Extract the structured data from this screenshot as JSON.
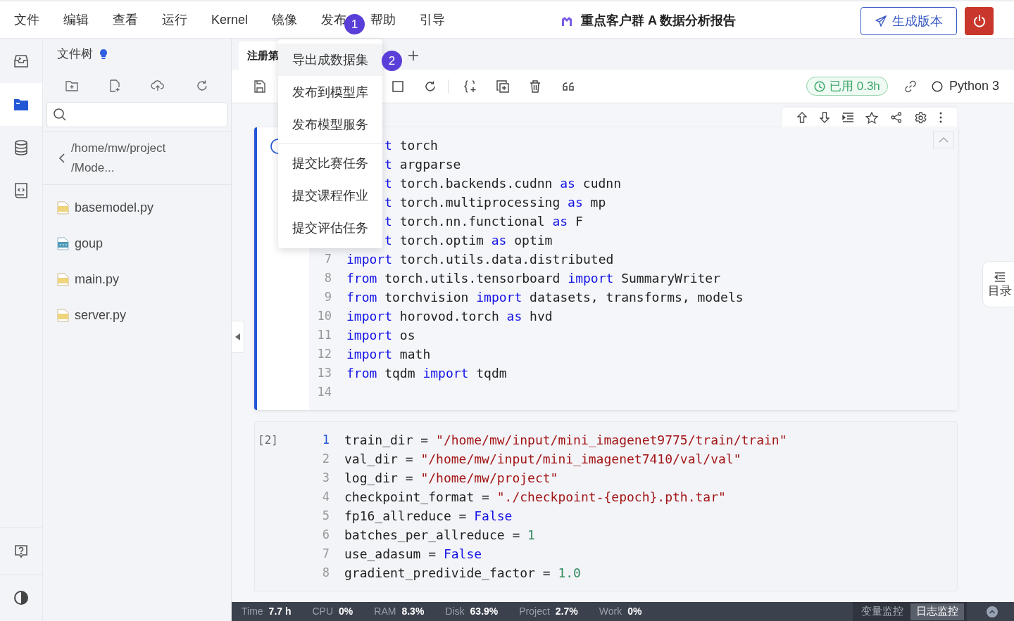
{
  "menu_bar": {
    "items": [
      {
        "label": "文件"
      },
      {
        "label": "编辑"
      },
      {
        "label": "查看"
      },
      {
        "label": "运行"
      },
      {
        "label": "Kernel"
      },
      {
        "label": "镜像"
      },
      {
        "label": "发布"
      },
      {
        "label": "帮助"
      },
      {
        "label": "引导"
      }
    ],
    "title": "重点客户群 A 数据分析报告",
    "generate_button": "生成版本"
  },
  "activity_bar": {
    "items": [
      {
        "selected": false
      },
      {
        "selected": true
      },
      {
        "selected": false
      },
      {
        "selected": false
      }
    ]
  },
  "file_panel": {
    "title": "文件树",
    "path_lines": [
      "/home/mw/project",
      "/Mode..."
    ],
    "files": [
      {
        "name": "basemodel.py",
        "kind": "py"
      },
      {
        "name": "goup",
        "kind": "binary"
      },
      {
        "name": "main.py",
        "kind": "py"
      },
      {
        "name": "server.py",
        "kind": "py"
      }
    ]
  },
  "publish_menu": {
    "items": [
      {
        "kind": "item",
        "label": "导出成数据集",
        "hovered": true
      },
      {
        "kind": "item",
        "label": "发布到模型库",
        "hovered": false
      },
      {
        "kind": "item",
        "label": "发布模型服务",
        "hovered": false
      },
      {
        "kind": "divider"
      },
      {
        "kind": "item",
        "label": "提交比赛任务",
        "hovered": false
      },
      {
        "kind": "item",
        "label": "提交课程作业",
        "hovered": false
      },
      {
        "kind": "item",
        "label": "提交评估任务",
        "hovered": false
      }
    ]
  },
  "callouts": [
    {
      "label": "1"
    },
    {
      "label": "2"
    }
  ],
  "notebook": {
    "tab": {
      "label": "注册第",
      "selected": true
    },
    "usage_badge": "已用 0.3h",
    "kernel": "Python 3",
    "cells": [
      {
        "selected": true,
        "lines": [
          {
            "tokens": [
              {
                "kind": "keyword",
                "text": "t"
              },
              {
                "kind": "plain",
                "text": " torch"
              }
            ]
          },
          {
            "tokens": [
              {
                "kind": "keyword",
                "text": "t"
              },
              {
                "kind": "plain",
                "text": " argparse"
              }
            ]
          },
          {
            "tokens": [
              {
                "kind": "keyword",
                "text": "t"
              },
              {
                "kind": "plain",
                "text": " torch.backends.cudnn "
              },
              {
                "kind": "keyword",
                "text": "as"
              },
              {
                "kind": "plain",
                "text": " cudnn"
              }
            ]
          },
          {
            "tokens": [
              {
                "kind": "keyword",
                "text": "t"
              },
              {
                "kind": "plain",
                "text": " torch.multiprocessing "
              },
              {
                "kind": "keyword",
                "text": "as"
              },
              {
                "kind": "plain",
                "text": " mp"
              }
            ]
          },
          {
            "tokens": [
              {
                "kind": "keyword",
                "text": "t"
              },
              {
                "kind": "plain",
                "text": " torch.nn.functional "
              },
              {
                "kind": "keyword",
                "text": "as"
              },
              {
                "kind": "plain",
                "text": " F"
              }
            ]
          },
          {
            "tokens": [
              {
                "kind": "keyword",
                "text": "t"
              },
              {
                "kind": "plain",
                "text": " torch.optim "
              },
              {
                "kind": "keyword",
                "text": "as"
              },
              {
                "kind": "plain",
                "text": " optim"
              }
            ]
          },
          {
            "num": "7",
            "tokens": [
              {
                "kind": "keyword",
                "text": "import"
              },
              {
                "kind": "plain",
                "text": " torch.utils.data.distributed"
              }
            ]
          },
          {
            "num": "8",
            "tokens": [
              {
                "kind": "keyword",
                "text": "from"
              },
              {
                "kind": "plain",
                "text": " torch.utils.tensorboard "
              },
              {
                "kind": "keyword",
                "text": "import"
              },
              {
                "kind": "plain",
                "text": " SummaryWriter"
              }
            ]
          },
          {
            "num": "9",
            "tokens": [
              {
                "kind": "keyword",
                "text": "from"
              },
              {
                "kind": "plain",
                "text": " torchvision "
              },
              {
                "kind": "keyword",
                "text": "import"
              },
              {
                "kind": "plain",
                "text": " datasets, transforms, models"
              }
            ]
          },
          {
            "num": "10",
            "tokens": [
              {
                "kind": "keyword",
                "text": "import"
              },
              {
                "kind": "plain",
                "text": " horovod.torch "
              },
              {
                "kind": "keyword",
                "text": "as"
              },
              {
                "kind": "plain",
                "text": " hvd"
              }
            ]
          },
          {
            "num": "11",
            "tokens": [
              {
                "kind": "keyword",
                "text": "import"
              },
              {
                "kind": "plain",
                "text": " os"
              }
            ]
          },
          {
            "num": "12",
            "tokens": [
              {
                "kind": "keyword",
                "text": "import"
              },
              {
                "kind": "plain",
                "text": " math"
              }
            ]
          },
          {
            "num": "13",
            "tokens": [
              {
                "kind": "keyword",
                "text": "from"
              },
              {
                "kind": "plain",
                "text": " tqdm "
              },
              {
                "kind": "keyword",
                "text": "import"
              },
              {
                "kind": "plain",
                "text": " tqdm"
              }
            ]
          },
          {
            "num": "14"
          }
        ]
      },
      {
        "selected": false,
        "prompt": "[2]",
        "lines": [
          {
            "num": "1",
            "current": true,
            "tokens": [
              {
                "kind": "plain",
                "text": "train_dir = "
              },
              {
                "kind": "string",
                "text": "\"/home/mw/input/mini_imagenet9775/train/train\""
              }
            ]
          },
          {
            "num": "2",
            "current": false,
            "tokens": [
              {
                "kind": "plain",
                "text": "val_dir = "
              },
              {
                "kind": "string",
                "text": "\"/home/mw/input/mini_imagenet7410/val/val\""
              }
            ]
          },
          {
            "num": "3",
            "current": false,
            "tokens": [
              {
                "kind": "plain",
                "text": "log_dir = "
              },
              {
                "kind": "string",
                "text": "\"/home/mw/project\""
              }
            ]
          },
          {
            "num": "4",
            "current": false,
            "tokens": [
              {
                "kind": "plain",
                "text": "checkpoint_format = "
              },
              {
                "kind": "string",
                "text": "\"./checkpoint-{epoch}.pth.tar\""
              }
            ]
          },
          {
            "num": "5",
            "current": false,
            "tokens": [
              {
                "kind": "plain",
                "text": "fp16_allreduce = "
              },
              {
                "kind": "keyword",
                "text": "False"
              }
            ]
          },
          {
            "num": "6",
            "current": false,
            "tokens": [
              {
                "kind": "plain",
                "text": "batches_per_allreduce = "
              },
              {
                "kind": "number",
                "text": "1"
              }
            ]
          },
          {
            "num": "7",
            "current": false,
            "tokens": [
              {
                "kind": "plain",
                "text": "use_adasum = "
              },
              {
                "kind": "keyword",
                "text": "False"
              }
            ]
          },
          {
            "num": "8",
            "current": false,
            "tokens": [
              {
                "kind": "plain",
                "text": "gradient_predivide_factor = "
              },
              {
                "kind": "number",
                "text": "1.0"
              }
            ]
          }
        ]
      }
    ]
  },
  "toc_label": "目录",
  "status_bar": {
    "metrics": [
      {
        "name": "Time",
        "value": "7.7 h"
      },
      {
        "name": "CPU",
        "value": "0%"
      },
      {
        "name": "RAM",
        "value": "8.3%"
      },
      {
        "name": "Disk",
        "value": "63.9%"
      },
      {
        "name": "Project",
        "value": "2.7%"
      },
      {
        "name": "Work",
        "value": "0%"
      }
    ],
    "tabs": [
      {
        "label": "变量监控",
        "selected": false
      },
      {
        "label": "日志监控",
        "selected": true
      }
    ]
  }
}
